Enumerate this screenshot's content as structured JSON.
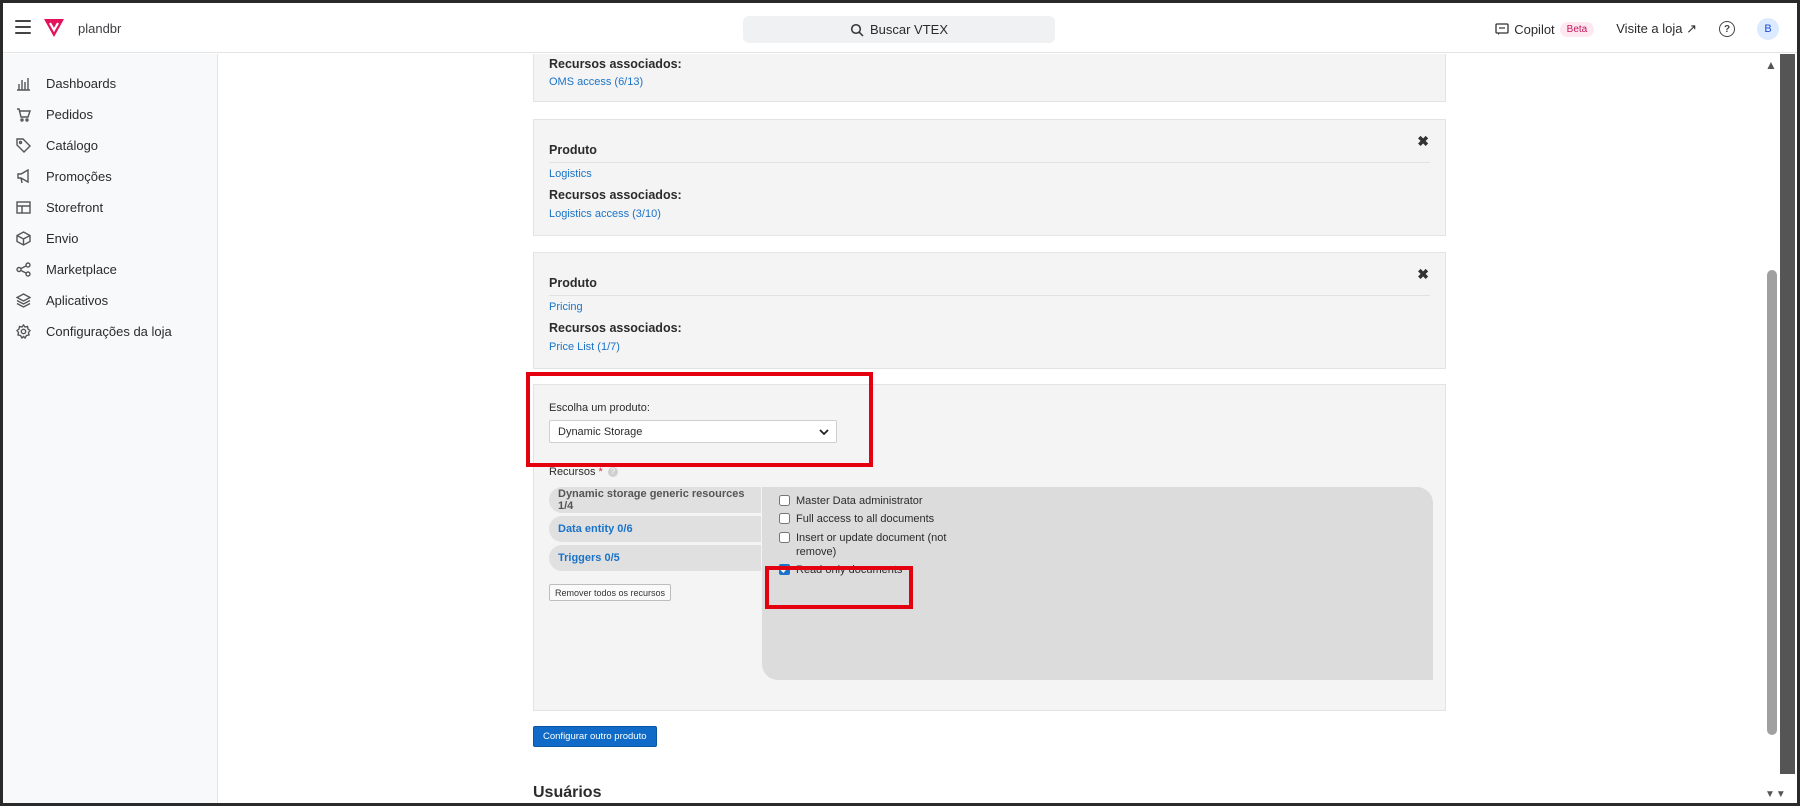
{
  "header": {
    "store_name": "plandbr",
    "search_label": "Buscar VTEX",
    "copilot_label": "Copilot",
    "beta_label": "Beta",
    "visit_label": "Visite a loja ↗",
    "help_label": "?",
    "avatar_initial": "B"
  },
  "sidebar": {
    "items": [
      {
        "label": "Dashboards",
        "icon": "chart-icon"
      },
      {
        "label": "Pedidos",
        "icon": "cart-icon"
      },
      {
        "label": "Catálogo",
        "icon": "tag-icon"
      },
      {
        "label": "Promoções",
        "icon": "megaphone-icon"
      },
      {
        "label": "Storefront",
        "icon": "layout-icon"
      },
      {
        "label": "Envio",
        "icon": "box-icon"
      },
      {
        "label": "Marketplace",
        "icon": "share-icon"
      },
      {
        "label": "Aplicativos",
        "icon": "layers-icon"
      },
      {
        "label": "Configurações da loja",
        "icon": "gear-icon"
      }
    ]
  },
  "cards": [
    {
      "resources_heading": "Recursos associados:",
      "resource_link": "OMS access (6/13)"
    },
    {
      "product_heading": "Produto",
      "product_name": "Logistics",
      "resources_heading": "Recursos associados:",
      "resource_link": "Logistics access (3/10)",
      "close": "✖"
    },
    {
      "product_heading": "Produto",
      "product_name": "Pricing",
      "resources_heading": "Recursos associados:",
      "resource_link": "Price List (1/7)",
      "close": "✖"
    }
  ],
  "chooser": {
    "label": "Escolha um produto:",
    "selected": "Dynamic Storage",
    "resources_label": "Recursos",
    "required_mark": "*",
    "tabs": [
      {
        "label": "Dynamic storage generic resources 1/4",
        "active": true
      },
      {
        "label": "Data entity 0/6",
        "active": false
      },
      {
        "label": "Triggers 0/5",
        "active": false
      }
    ],
    "remove_all_label": "Remover todos os recursos",
    "checkboxes": [
      {
        "label": "Master Data administrator",
        "checked": false
      },
      {
        "label": "Full access to all documents",
        "checked": false
      },
      {
        "label": "Insert or update document (not remove)",
        "checked": false
      },
      {
        "label": "Read only documents",
        "checked": true
      }
    ]
  },
  "configure_button": "Configurar outro produto",
  "users_section_title": "Usuários",
  "colors": {
    "accent": "#0f6bc7",
    "link": "#1a73c9",
    "highlight": "#e4000f",
    "logo": "#e3125b"
  }
}
